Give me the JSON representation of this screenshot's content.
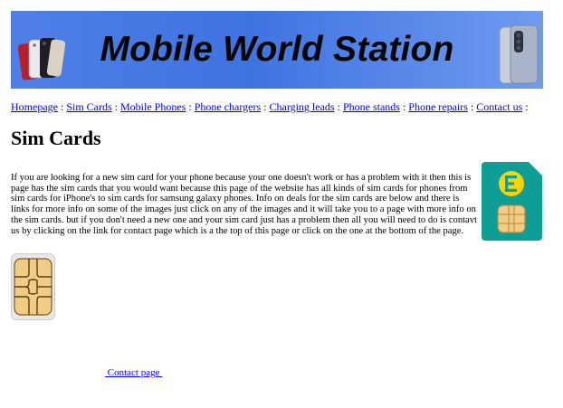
{
  "banner": {
    "title": "Mobile World Station",
    "left_image": "iphone-se-phones-icon",
    "right_image": "samsung-foldable-phone-icon"
  },
  "nav": {
    "items": [
      {
        "label": "Homepage"
      },
      {
        "label": "Sim Cards"
      },
      {
        "label": "Mobile Phones"
      },
      {
        "label": "Phone chargers"
      },
      {
        "label": "Charging leads"
      },
      {
        "label": "Phone stands"
      },
      {
        "label": "Phone repairs"
      },
      {
        "label": "Contact us"
      }
    ],
    "separator": " : "
  },
  "page": {
    "heading": "Sim Cards",
    "intro": "If you are looking for a new sim card for your phone because your one doesn't work or has a problem with it then this is page has the sim cards that you would want because this page of the website has all kinds of sim cards for phones from sim cards for iPhone's to sim cards for samsung galaxy phones. Info on deals for the sim cards are below and there is links for more info on some of the images just click on any of the images and it will take you to a page with more info on the sim cards. but if you don't need a new one and your sim card just has a problem then all you will need to do is contavt us by clicking on the link for contact page which is a the top of this page or click on the one at the bottom of the page.",
    "contact_link": " Contact page "
  },
  "images": {
    "ee_sim_card": "ee-sim-card-icon",
    "sim_chip": "sim-chip-icon"
  },
  "colors": {
    "banner_blue": "#3f73e0",
    "link_blue": "#0000ee",
    "ee_teal": "#0f9e95",
    "ee_yellow": "#ffd200",
    "chip_gold": "#f0cc86"
  }
}
